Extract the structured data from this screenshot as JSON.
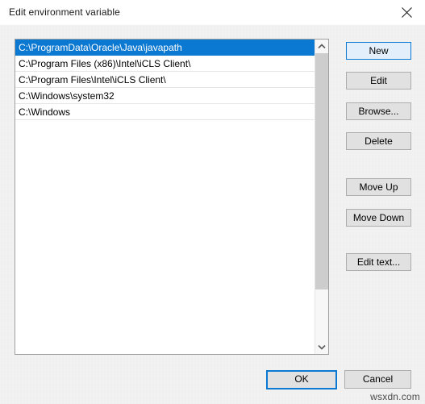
{
  "window": {
    "title": "Edit environment variable",
    "close_label": "Close"
  },
  "list": {
    "items": [
      {
        "path": "C:\\ProgramData\\Oracle\\Java\\javapath",
        "selected": true
      },
      {
        "path": "C:\\Program Files (x86)\\Intel\\iCLS Client\\",
        "selected": false
      },
      {
        "path": "C:\\Program Files\\Intel\\iCLS Client\\",
        "selected": false
      },
      {
        "path": "C:\\Windows\\system32",
        "selected": false
      },
      {
        "path": "C:\\Windows",
        "selected": false
      }
    ],
    "scrollbar": {
      "up_arrow": "chevron-up-icon",
      "down_arrow": "chevron-down-icon"
    }
  },
  "side_buttons": {
    "new": "New",
    "edit": "Edit",
    "browse": "Browse...",
    "delete": "Delete",
    "move_up": "Move Up",
    "move_down": "Move Down",
    "edit_text": "Edit text..."
  },
  "footer": {
    "ok": "OK",
    "cancel": "Cancel"
  },
  "watermark": {
    "text": "wsxdn.com"
  },
  "colors": {
    "accent": "#0b78d1",
    "selection_bg": "#0b78d1",
    "selection_fg": "#ffffff",
    "dialog_bg": "#f1f1f1",
    "button_bg": "#e1e1e1",
    "button_border": "#adadad",
    "focused_button_bg": "#e3f0fb"
  }
}
